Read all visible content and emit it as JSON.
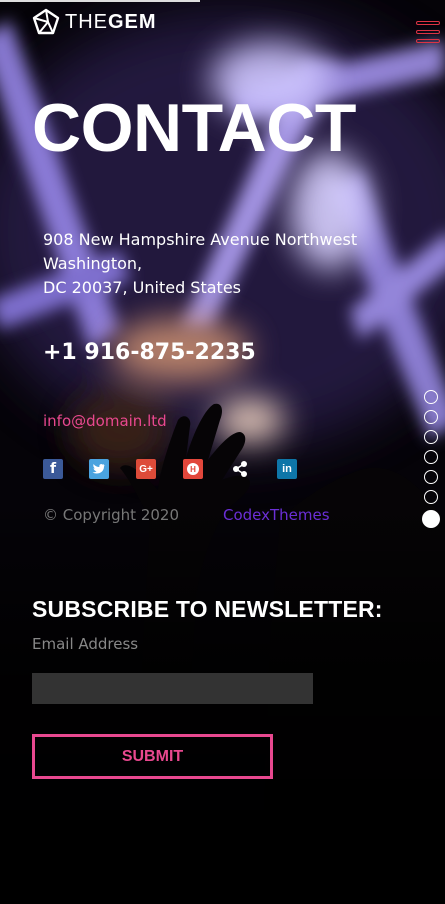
{
  "header": {
    "logo_prefix": "THE",
    "logo_bold": "GEM",
    "menu_icon": "hamburger-menu-icon"
  },
  "hero": {
    "title": "CONTACT"
  },
  "contact": {
    "address_line1": "908 New Hampshire Avenue Northwest",
    "address_line2": "Washington,",
    "address_line3": "DC 20037, United States",
    "phone": "+1 916-875-2235",
    "email": "info@domain.ltd"
  },
  "social": {
    "facebook_glyph": "f",
    "twitter_glyph": "t",
    "googleplus_glyph": "G+",
    "hangouts_glyph": "H",
    "share_glyph": "share",
    "linkedin_glyph": "in",
    "icons": [
      "facebook-icon",
      "twitter-icon",
      "google-plus-icon",
      "hangouts-icon",
      "share-icon",
      "linkedin-icon"
    ]
  },
  "footer": {
    "copyright": "© Copyright 2020",
    "credit": "CodexThemes"
  },
  "pagination": {
    "total": 7,
    "active_index": 6
  },
  "newsletter": {
    "title": "SUBSCRIBE TO NEWSLETTER:",
    "email_label": "Email Address",
    "email_value": "",
    "submit_label": "SUBMIT"
  },
  "colors": {
    "accent": "#e8488f",
    "credit": "#6b2fd6",
    "facebook": "#3b5998",
    "twitter": "#4aa3df",
    "googleplus": "#dd4b39",
    "hangouts": "#e2473b",
    "linkedin": "#0e76a8"
  }
}
